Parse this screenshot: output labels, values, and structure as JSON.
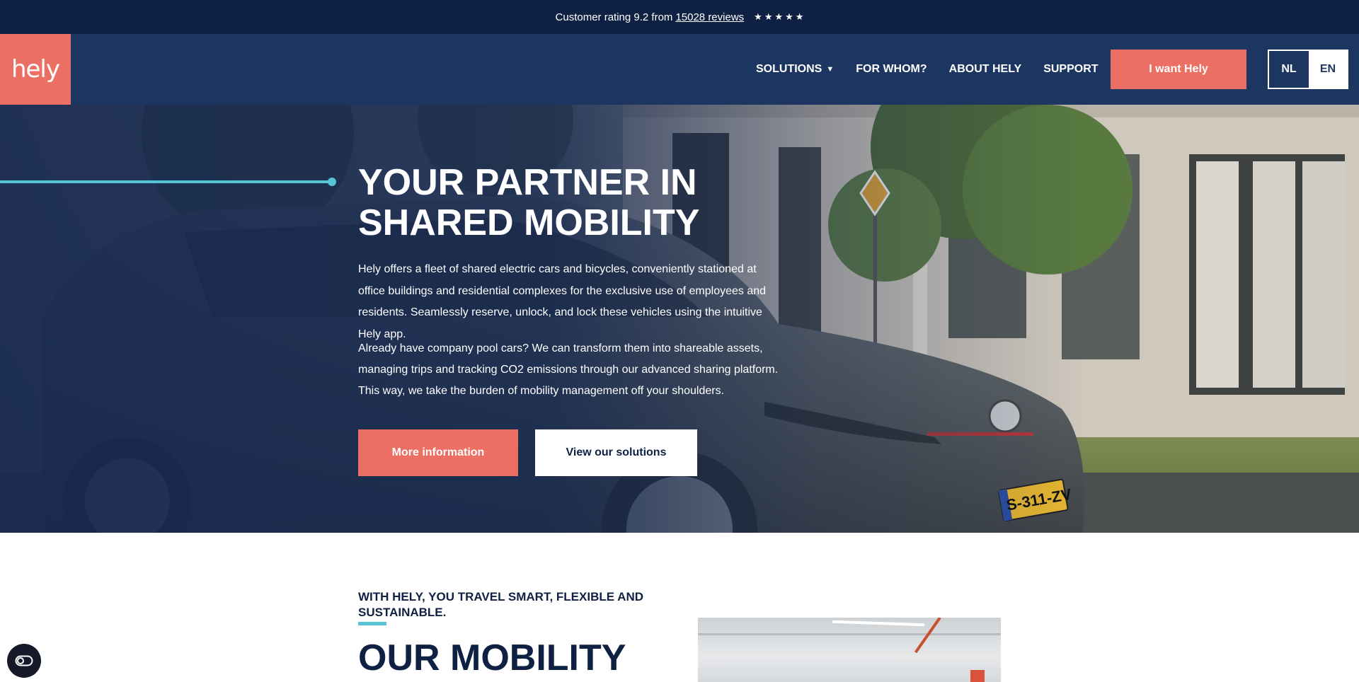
{
  "topbar": {
    "rating_text": "Customer rating 9.2 from",
    "reviews_link": "15028 reviews",
    "stars": [
      "★",
      "★",
      "★",
      "★",
      "★"
    ]
  },
  "header": {
    "logo_text": "hely",
    "nav": {
      "solutions": "SOLUTIONS",
      "for_whom": "FOR WHOM?",
      "about": "ABOUT HELY",
      "support": "SUPPORT"
    },
    "cta": "I want Hely",
    "languages": [
      "NL",
      "EN"
    ],
    "active_language": "EN"
  },
  "hero": {
    "title": "YOUR PARTNER IN SHARED MOBILITY",
    "paragraph1": "Hely offers a fleet of shared electric cars and bicycles, conveniently stationed at office buildings and residential complexes for the exclusive use of employees and residents. Seamlessly reserve, unlock, and lock these vehicles using the intuitive Hely app.",
    "paragraph2": "Already have company pool cars? We can transform them into shareable assets, managing trips and tracking CO2 emissions through our advanced sharing platform. This way, we take the burden of mobility management off your shoulders.",
    "primary_button": "More information",
    "secondary_button": "View our solutions",
    "license_plate": "S-311-ZV"
  },
  "section": {
    "kicker": "WITH HELY, YOU TRAVEL SMART, FLEXIBLE AND SUSTAINABLE.",
    "title": "OUR MOBILITY"
  },
  "colors": {
    "navy_dark": "#0f2143",
    "navy": "#1d3661",
    "coral": "#ec6f63",
    "cyan": "#55c5d6",
    "white": "#ffffff"
  }
}
